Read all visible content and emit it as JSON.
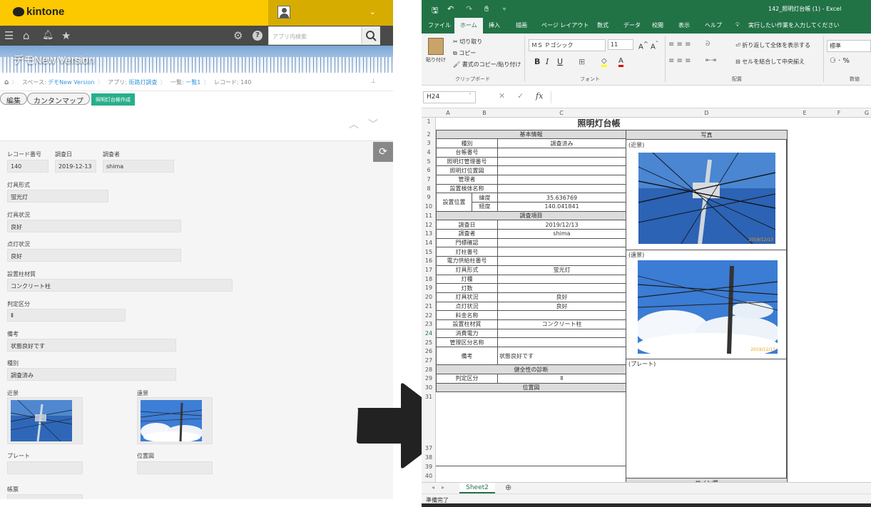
{
  "kintone": {
    "logo": "kintone",
    "search_placeholder": "アプリ内検索",
    "banner_title": "デモNew Version",
    "breadcrumbs": {
      "space_prefix": "スペース: ",
      "space": "デモNew Version",
      "app_prefix": "アプリ: ",
      "app": "街路灯調査",
      "list_prefix": "一覧: ",
      "list": "一覧1",
      "record": "レコード: 140"
    },
    "buttons": {
      "edit": "編集",
      "map": "カンタンマップ",
      "create_ledger": "照明灯台帳作成"
    },
    "fields": {
      "record_no": {
        "label": "レコード番号",
        "value": "140"
      },
      "survey_date": {
        "label": "調査日",
        "value": "2019-12-13"
      },
      "surveyor": {
        "label": "調査者",
        "value": "shima"
      },
      "lamp_type": {
        "label": "灯具形式",
        "value": "蛍光灯"
      },
      "lamp_status": {
        "label": "灯具状況",
        "value": "良好"
      },
      "lighting_status": {
        "label": "点灯状況",
        "value": "良好"
      },
      "pole_material": {
        "label": "設置柱材質",
        "value": "コンクリート柱"
      },
      "judgement": {
        "label": "判定区分",
        "value": "Ⅱ"
      },
      "remarks": {
        "label": "備考",
        "value": "状態良好です"
      },
      "kind": {
        "label": "種別",
        "value": "調査済み"
      },
      "near": {
        "label": "近景"
      },
      "far": {
        "label": "遠景"
      },
      "plate": {
        "label": "プレート"
      },
      "location_map": {
        "label": "位置図"
      },
      "form": {
        "label": "帳票"
      }
    }
  },
  "excel": {
    "doc_title": "142_照明灯台帳 (1) - Excel",
    "tabs": [
      "ファイル",
      "ホーム",
      "挿入",
      "描画",
      "ページ レイアウト",
      "数式",
      "データ",
      "校閲",
      "表示",
      "ヘルプ"
    ],
    "tell_me": "実行したい作業を入力してください",
    "ribbon": {
      "paste": "貼り付け",
      "cut": "切り取り",
      "copy": "コピー",
      "format_painter": "書式のコピー/貼り付け",
      "clipboard": "クリップボード",
      "font_name": "ＭＳ Ｐゴシック",
      "font_size": "11",
      "font_group": "フォント",
      "wrap_text": "折り返して全体を表示する",
      "merge_center": "セルを結合して中央揃え",
      "alignment_group": "配置",
      "number_format": "標準",
      "number_group": "数値",
      "bold": "B",
      "italic": "I",
      "underline": "U"
    },
    "name_box": "H24",
    "columns": [
      "A",
      "B",
      "C",
      "D",
      "E",
      "F",
      "G"
    ],
    "rows": [
      "1",
      "2",
      "3",
      "4",
      "5",
      "6",
      "7",
      "8",
      "9",
      "10",
      "11",
      "12",
      "13",
      "14",
      "15",
      "16",
      "17",
      "18",
      "19",
      "20",
      "21",
      "22",
      "23",
      "24",
      "25",
      "26",
      "27",
      "28",
      "29",
      "30",
      "31",
      "37",
      "38",
      "39",
      "40"
    ],
    "ledger": {
      "title": "照明灯台帳",
      "basic_info": "基本情報",
      "photo": "写真",
      "rows1": [
        {
          "label": "種別",
          "value": "調査済み"
        },
        {
          "label": "台帳番号",
          "value": ""
        },
        {
          "label": "照明灯管理番号",
          "value": ""
        },
        {
          "label": "照明灯位置図",
          "value": ""
        },
        {
          "label": "管理者",
          "value": ""
        },
        {
          "label": "設置検体名称",
          "value": ""
        }
      ],
      "location": {
        "label": "設置位置",
        "lat_label": "緯度",
        "lat": "35.636769",
        "lng_label": "経度",
        "lng": "140.041841"
      },
      "survey_items": "調査項目",
      "rows2": [
        {
          "label": "調査日",
          "value": "2019/12/13"
        },
        {
          "label": "調査者",
          "value": "shima"
        },
        {
          "label": "門標確認",
          "value": ""
        },
        {
          "label": "灯柱番号",
          "value": ""
        },
        {
          "label": "電力供給柱番号",
          "value": ""
        },
        {
          "label": "灯具形式",
          "value": "蛍光灯"
        },
        {
          "label": "灯種",
          "value": ""
        },
        {
          "label": "灯数",
          "value": ""
        },
        {
          "label": "灯具状況",
          "value": "良好"
        },
        {
          "label": "点灯状況",
          "value": "良好"
        },
        {
          "label": "料金名称",
          "value": ""
        },
        {
          "label": "設置柱材質",
          "value": "コンクリート柱"
        },
        {
          "label": "消費電力",
          "value": ""
        },
        {
          "label": "管理区分名称",
          "value": ""
        }
      ],
      "remarks_label": "備考",
      "remarks_value": "状態良好です",
      "health": "健全性の診断",
      "judgement_label": "判定区分",
      "judgement_value": "Ⅱ",
      "location_map": "位置図",
      "near_label": "(近景)",
      "far_label": "(遠景)",
      "plate_label": "(プレート)",
      "photo_date": "2019/12/13",
      "sign": "サイン欄"
    },
    "sheet_tab": "Sheet2",
    "status": "準備完了"
  },
  "colors": {
    "kintone_yellow": "#fcc800",
    "excel_green": "#217346",
    "accent_green": "#27ae8a"
  }
}
